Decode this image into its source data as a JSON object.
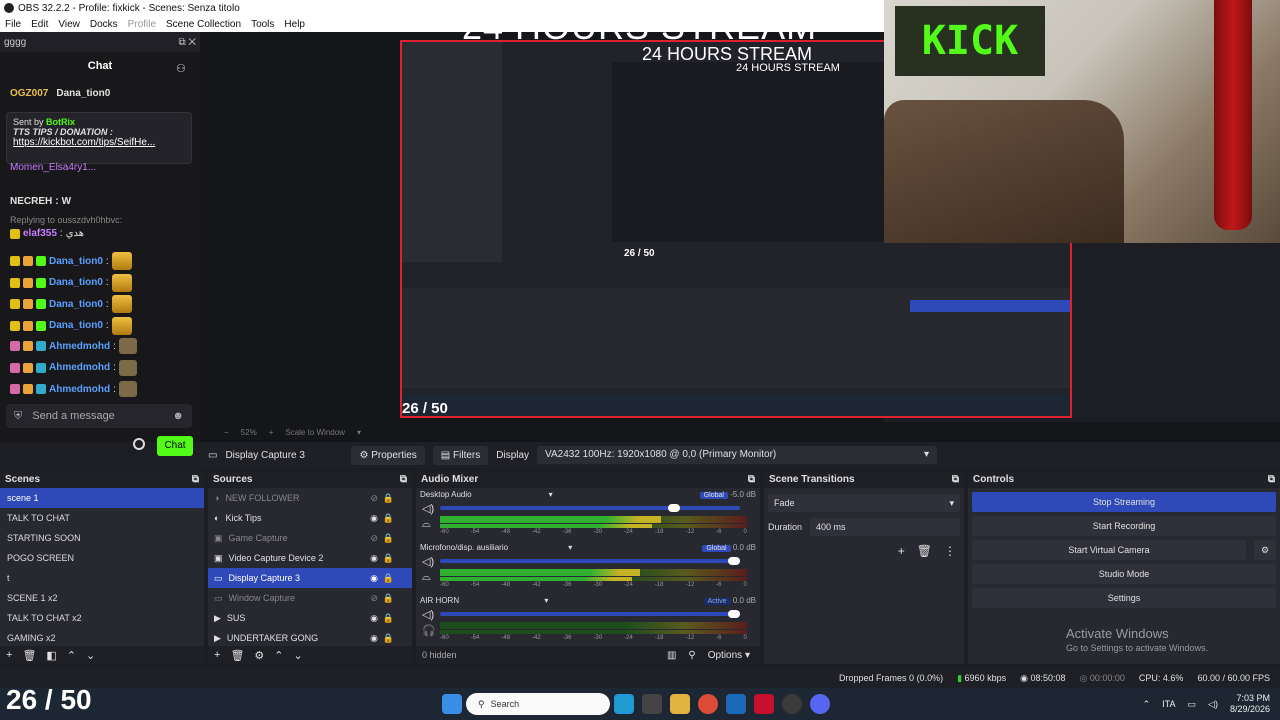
{
  "window": {
    "title": "OBS 32.2.2 - Profile: fixkick - Scenes: Senza titolo"
  },
  "menu": [
    "File",
    "Edit",
    "View",
    "Docks",
    "Profile",
    "Scene Collection",
    "Tools",
    "Help"
  ],
  "chat": {
    "dock_title": "gggg",
    "title": "Chat",
    "top_users": [
      "OGZ007",
      "Dana_tion0"
    ],
    "pinned_prefix": "Sent by",
    "pinned_bot": "BotRix",
    "pinned_text": "TTS TIPS / DONATION :",
    "pinned_link": "https://kickbot.com/tips/SeifHe...",
    "partial_user": "Momen_Elsa4ry1...",
    "message_user": "NECREH",
    "message_text": "W",
    "reply_line": "Replying to ousszdvh0hbvc:",
    "elaf_user": "elaf355",
    "elaf_text": "هدي",
    "rows": [
      {
        "user": "Dana_tion0"
      },
      {
        "user": "Dana_tion0"
      },
      {
        "user": "Dana_tion0"
      },
      {
        "user": "Dana_tion0"
      },
      {
        "user": "Ahmedmohd"
      },
      {
        "user": "Ahmedmohd"
      },
      {
        "user": "Ahmedmohd"
      }
    ],
    "input_placeholder": "Send a message",
    "send_label": "Chat"
  },
  "preview": {
    "overlay_title": "24 HOURS STREAM",
    "counter": "26 / 50",
    "kick_sign": "KICK",
    "zoom": "52%",
    "scale_label": "Scale to Window"
  },
  "propbar": {
    "source_name": "Display Capture 3",
    "properties_label": "Properties",
    "filters_label": "Filters",
    "display_label": "Display",
    "display_value": "VA2432 100Hz: 1920x1080 @ 0,0 (Primary Monitor)"
  },
  "scenes": {
    "header": "Scenes",
    "items": [
      "scene 1",
      "TALK TO CHAT",
      "STARTING SOON",
      "POGO SCREEN",
      "t",
      "SCENE 1 x2",
      "TALK TO CHAT x2",
      "GAMING x2"
    ],
    "selected": 0
  },
  "sources": {
    "header": "Sources",
    "items": [
      {
        "name": "NEW FOLLOWER",
        "dim": true
      },
      {
        "name": "Kick Tips",
        "dim": false
      },
      {
        "name": "Game Capture",
        "dim": true
      },
      {
        "name": "Video Capture Device 2",
        "dim": false
      },
      {
        "name": "Display Capture 3",
        "dim": false
      },
      {
        "name": "Window Capture",
        "dim": true
      },
      {
        "name": "SUS",
        "dim": false
      },
      {
        "name": "UNDERTAKER GONG",
        "dim": false
      }
    ],
    "selected": 4
  },
  "mixer": {
    "header": "Audio Mixer",
    "channels": [
      {
        "name": "Desktop Audio",
        "tag": "Global",
        "db": "-5.0 dB",
        "level": 0.72,
        "volume": 0.8
      },
      {
        "name": "Microfono/disp. ausiliario",
        "tag": "Global",
        "db": "0.0 dB",
        "level": 0.65,
        "volume": 1.0
      },
      {
        "name": "AIR HORN",
        "tag": "Active",
        "db": "0.0 dB",
        "level": 0.0,
        "volume": 1.0
      }
    ],
    "scale": [
      "-60",
      "-54",
      "-48",
      "-42",
      "-36",
      "-30",
      "-24",
      "-18",
      "-12",
      "-6",
      "0"
    ],
    "hidden": "0 hidden",
    "options": "Options"
  },
  "transitions": {
    "header": "Scene Transitions",
    "value": "Fade",
    "duration_label": "Duration",
    "duration_value": "400 ms"
  },
  "controls": {
    "header": "Controls",
    "buttons": [
      "Stop Streaming",
      "Start Recording",
      "Start Virtual Camera",
      "Studio Mode",
      "Settings"
    ]
  },
  "activate": {
    "title": "Activate Windows",
    "subtitle": "Go to Settings to activate Windows."
  },
  "status": {
    "dropped": "Dropped Frames 0 (0.0%)",
    "bitrate": "6960 kbps",
    "stream_time": "08:50:08",
    "rec_time": "00:00:00",
    "cpu": "CPU: 4.6%",
    "fps": "60.00 / 60.00 FPS"
  },
  "taskbar": {
    "search": "Search",
    "lang": "ITA",
    "time": "7:03 PM",
    "date": "8/29/2026",
    "counter": "26 / 50"
  },
  "colors": {
    "accent": "#2f4ab8",
    "kick_green": "#53fc18",
    "red_border": "#e0202e"
  }
}
